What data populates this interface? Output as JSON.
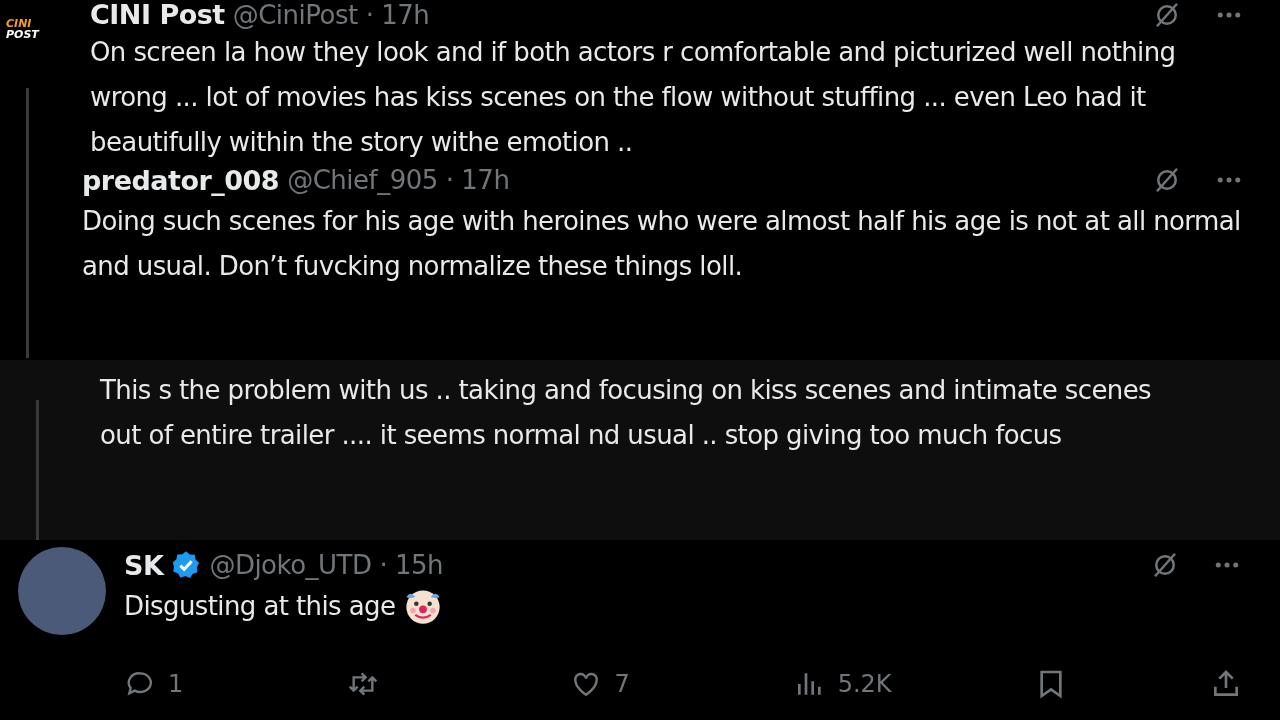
{
  "thread_top": {
    "post": {
      "name": "CINI Post",
      "handle": "@CiniPost",
      "time": "· 17h",
      "logo_text": [
        "CINI",
        "POST"
      ],
      "text": "On screen la how they look and if both actors r comfortable and picturized well nothing wrong ... lot of movies has kiss scenes on the flow without stuffing ... even Leo had it beautifully within the story withe emotion .."
    },
    "reply": {
      "name": "predator_008",
      "handle": "@Chief_905",
      "time": "· 17h",
      "text": "Doing such scenes for his age with heroines who were almost half his age is not at all normal and usual. Don’t fuvcking normalize these things loll."
    }
  },
  "thread_middle": {
    "text": "This s the problem with us .. taking and focusing on kiss scenes and intimate scenes out of entire trailer .... it seems normal nd usual .. stop giving too much focus"
  },
  "bottom_post": {
    "name": "SK",
    "verified": true,
    "handle": "@Djoko_UTD",
    "time": "· 15h",
    "text": "Disgusting at this age",
    "actions": [
      {
        "kind": "reply",
        "count": "1"
      },
      {
        "kind": "repost"
      },
      {
        "kind": "like",
        "count": "7"
      },
      {
        "kind": "views",
        "count": "5.2K"
      },
      {
        "kind": "bookmark"
      },
      {
        "kind": "share"
      }
    ]
  }
}
